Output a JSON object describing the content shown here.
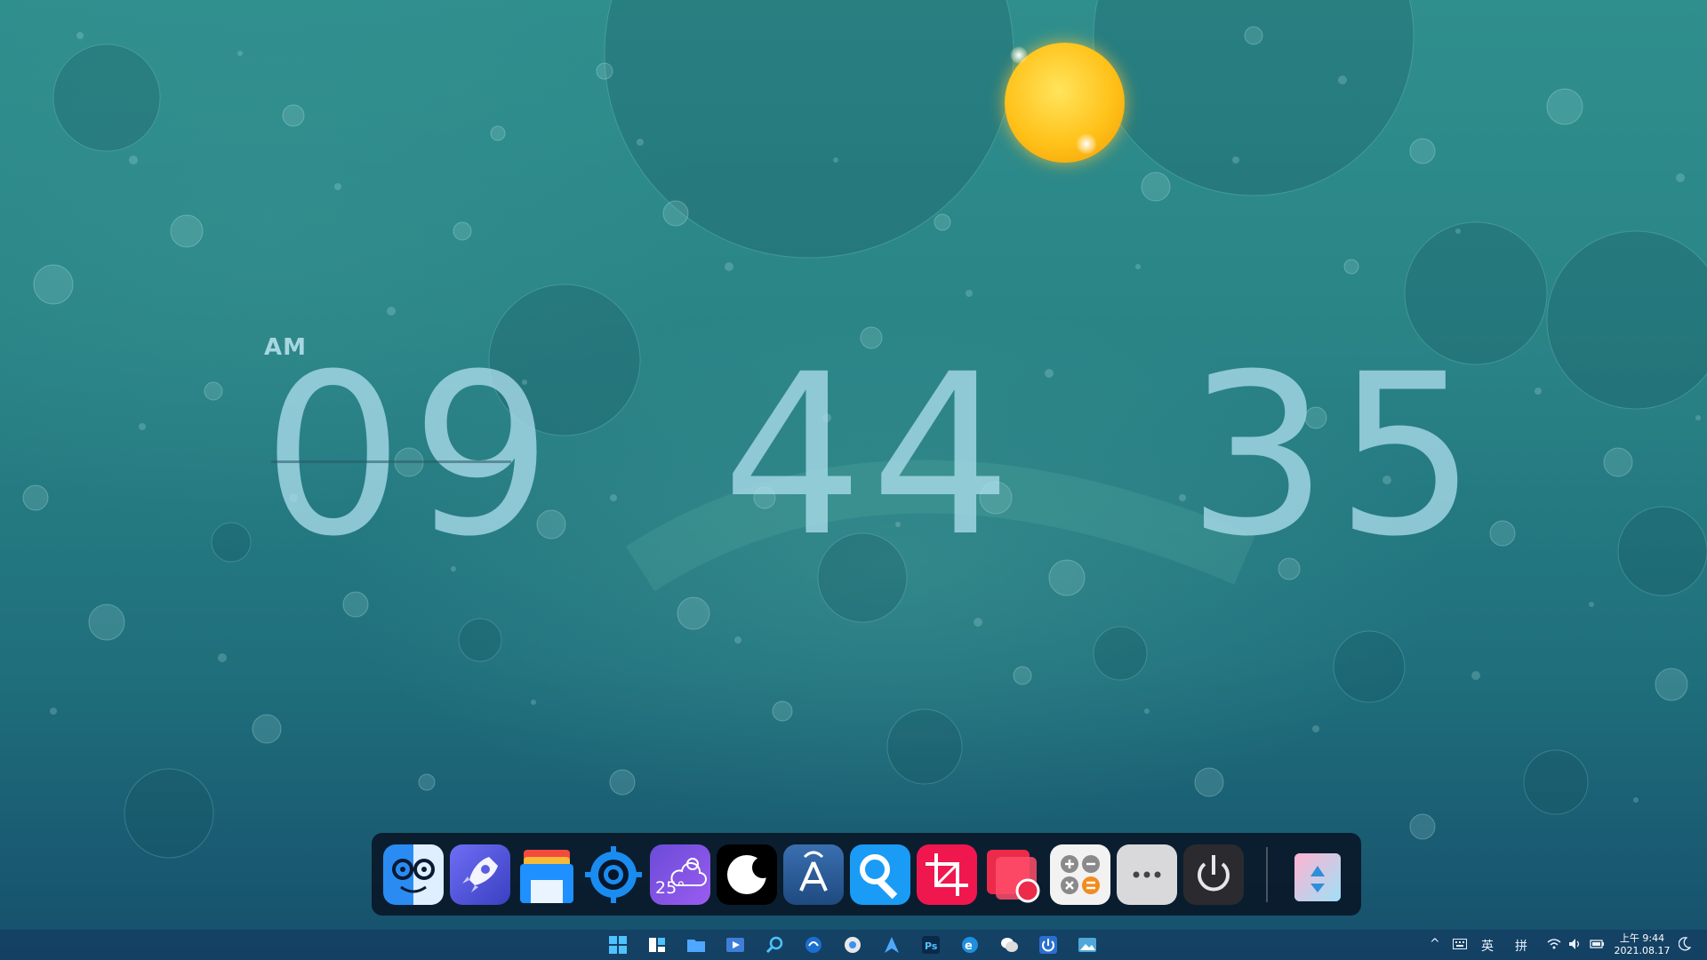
{
  "clock": {
    "period": "AM",
    "hours": "09",
    "minutes": "44",
    "seconds": "35"
  },
  "dock": {
    "apps": [
      {
        "name": "finder",
        "icon": "finder-face-icon"
      },
      {
        "name": "launchpad",
        "icon": "rocket-icon"
      },
      {
        "name": "files",
        "icon": "folder-stack-icon"
      },
      {
        "name": "settings",
        "icon": "gear-icon"
      },
      {
        "name": "weather",
        "icon": "weather-cloud-icon",
        "label": "25°"
      },
      {
        "name": "moon",
        "icon": "moon-icon"
      },
      {
        "name": "app-store",
        "icon": "app-store-icon"
      },
      {
        "name": "search",
        "icon": "magnifier-icon"
      },
      {
        "name": "crop",
        "icon": "crop-icon"
      },
      {
        "name": "screen-record",
        "icon": "record-icon"
      },
      {
        "name": "calculator",
        "icon": "calculator-icon"
      },
      {
        "name": "more",
        "icon": "more-dots-icon"
      },
      {
        "name": "power",
        "icon": "power-icon"
      },
      {
        "name": "recycle-bin",
        "icon": "recycle-bin-icon"
      }
    ]
  },
  "taskbar": {
    "tray": {
      "lang1": "英",
      "lang2": "拼",
      "time": "上午 9:44",
      "date": "2021.08.17"
    }
  },
  "colors": {
    "wallpaper_top": "#2f8f8d",
    "wallpaper_bottom": "#164f6c",
    "dock_bg": "#08162a",
    "clock_text": "#aadceb"
  }
}
